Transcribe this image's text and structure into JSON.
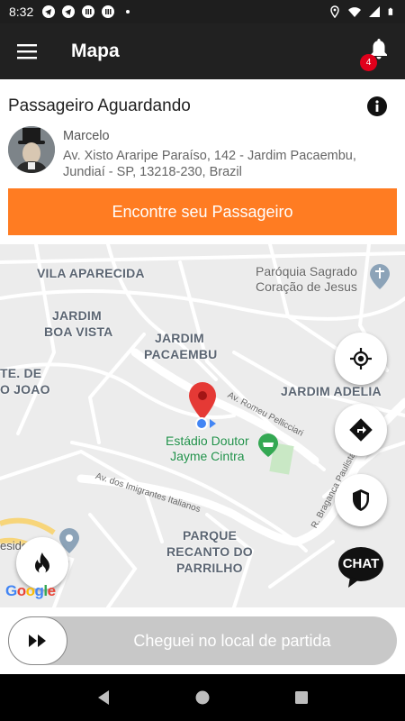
{
  "status_bar": {
    "time": "8:32"
  },
  "app_bar": {
    "title": "Mapa",
    "notification_count": "4"
  },
  "ride_card": {
    "heading": "Passageiro Aguardando",
    "passenger_name": "Marcelo",
    "address": "Av. Xisto Araripe Paraíso, 142 - Jardim Pacaembu, Jundiaí - SP, 13218-230, Brazil",
    "find_button": "Encontre seu Passageiro"
  },
  "map": {
    "areas": {
      "vila_aparecida": "VILA APARECIDA",
      "jardim_boa_vista_1": "JARDIM",
      "jardim_boa_vista_2": "BOA VISTA",
      "jardim_pacaembu_1": "JARDIM",
      "jardim_pacaembu_2": "PACAEMBU",
      "jardim_adelia": "JARDIM ADELIA",
      "sao_joao_1": "TE. DE",
      "sao_joao_2": "O JOAO",
      "parque_1": "PARQUE",
      "parque_2": "RECANTO DO",
      "parque_3": "PARRILHO",
      "reside": "eside"
    },
    "streets": {
      "romeu": "Av. Romeu Pellicciari",
      "imigrantes": "Av. dos Imigrantes Italianos",
      "braganca": "R. Bragança Paulista"
    },
    "poi": {
      "line1": "Estádio Doutor",
      "line2": "Jayme Cintra"
    },
    "church": {
      "line1": "Paróquia Sagrado",
      "line2": "Coração de Jesus"
    },
    "chat_label": "CHAT",
    "google_logo": "Google"
  },
  "slider": {
    "label": "Cheguei no local de partida"
  },
  "colors": {
    "accent": "#ff7c22",
    "app_bar": "#212121",
    "badge": "#e0001b",
    "pin": "#e53935"
  }
}
